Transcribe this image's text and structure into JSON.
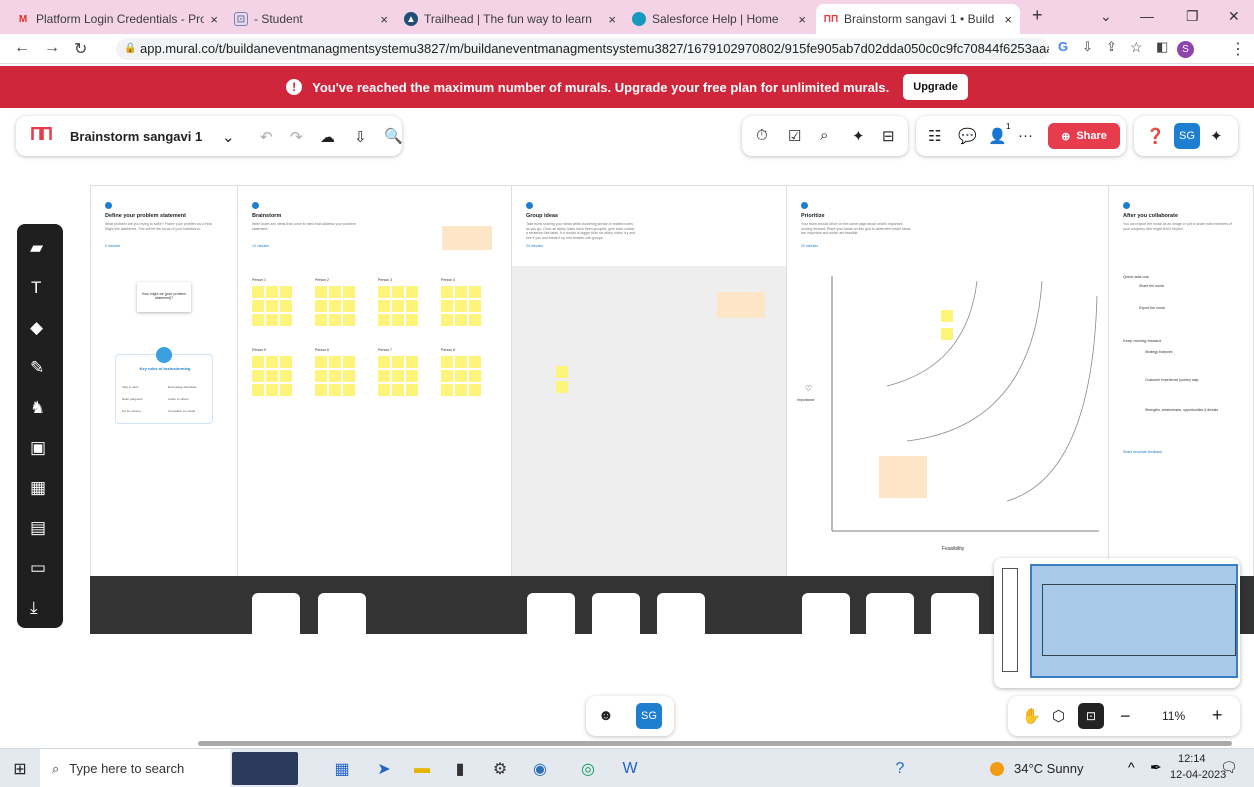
{
  "browser": {
    "tabs": [
      {
        "label": "Platform Login Credentials - Pro",
        "icon": "gmail-icon"
      },
      {
        "label": "- Student",
        "icon": "student-icon"
      },
      {
        "label": "Trailhead | The fun way to learn",
        "icon": "trailhead-icon"
      },
      {
        "label": "Salesforce Help | Home",
        "icon": "salesforce-icon"
      },
      {
        "label": "Brainstorm sangavi 1 • Build an",
        "icon": "mural-icon"
      }
    ],
    "url": "app.mural.co/t/buildaneventmanagmentsystemu3827/m/buildaneventmanagmentsystemu3827/1679102970802/915fe905ab7d02dda050c0c9fc70844f6253aaaa?sender=...",
    "profile_initial": "S"
  },
  "banner": {
    "message": "You've reached the maximum number of murals. Upgrade your free plan for unlimited murals.",
    "button": "Upgrade"
  },
  "toolbar": {
    "title": "Brainstorm sangavi 1",
    "share": "Share",
    "avatar": "SG",
    "presence_count": "1"
  },
  "board": {
    "columns": [
      {
        "title": "Define your problem statement",
        "desc": "What problem are you trying to solve? Frame your problem as a How Might We statement. This will be the focus of your brainstorm.",
        "time": "5 minutes"
      },
      {
        "title": "Brainstorm",
        "desc": "Write down any ideas that come to mind that address your problem statement.",
        "time": "10 minutes"
      },
      {
        "title": "Group ideas",
        "desc": "Take turns sharing your ideas while clustering similar or related notes as you go. Once all sticky notes have been grouped, give each cluster a sentence-like label. If a cluster is bigger than six sticky notes, try and see if you and break it up into smaller sub-groups.",
        "time": "20 minutes"
      },
      {
        "title": "Prioritize",
        "desc": "Your team should all be on the same page about what's important moving forward. Place your ideas on this grid to determine which ideas are important and which are feasible.",
        "time": "20 minutes"
      },
      {
        "title": "After you collaborate",
        "desc": "You can export the mural as an image or pdf to share with members of your company who might find it helpful.",
        "time": ""
      }
    ],
    "hmw_card": "How might we [your problem statement]?",
    "rules_title": "Key rules of brainstorming",
    "rules": [
      "Stay in topic",
      "Encourage wild ideas",
      "Defer judgment",
      "Listen to others",
      "Go for volume",
      "If possible, be visual"
    ],
    "persons": [
      "Person 1",
      "Person 2",
      "Person 3",
      "Person 4",
      "Person 5",
      "Person 6",
      "Person 7",
      "Person 8"
    ],
    "importance": "Importance",
    "feasibility": "Feasibility",
    "quick_add": "Quick add-ons",
    "keep_moving": "Keep moving forward",
    "quick_items": [
      "Share the mural",
      "Export the mural"
    ],
    "keep_items": [
      "Strategy blueprint",
      "Customer experience journey map",
      "Strengths, weaknesses, opportunities & threats"
    ],
    "share_feedback": "Share template feedback"
  },
  "bottom": {
    "avatar": "SG",
    "zoom": "11%"
  },
  "taskbar": {
    "search": "Type here to search",
    "weather": "34°C Sunny",
    "time": "12:14",
    "date": "12-04-2023"
  }
}
